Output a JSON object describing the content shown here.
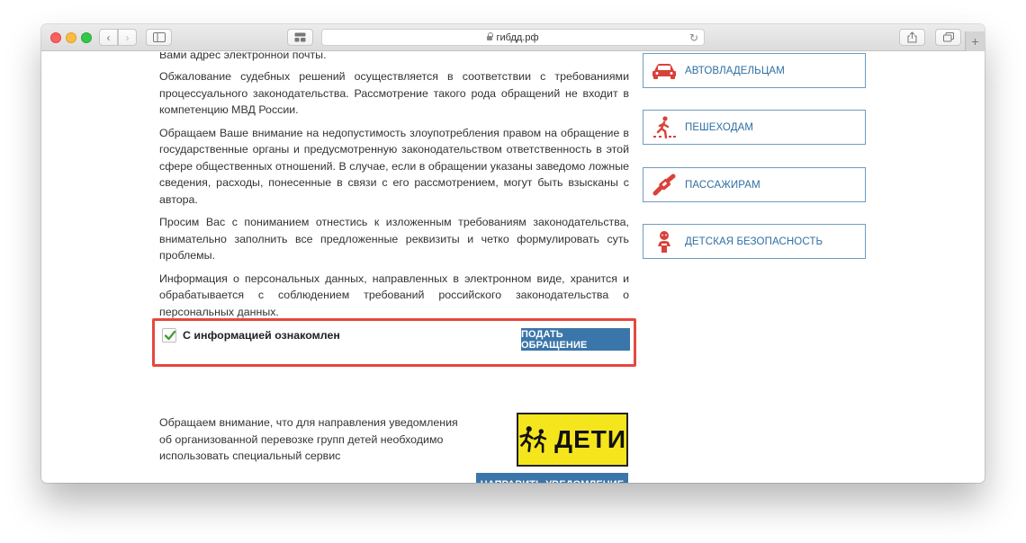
{
  "browser": {
    "address": "гибдд.рф",
    "back_glyph": "‹",
    "forward_glyph": "›",
    "new_tab_glyph": "+",
    "reload_glyph": "↻"
  },
  "main": {
    "paragraphs": [
      "Вами адрес электронной почты.",
      "Обжалование судебных решений осуществляется в соответствии с требованиями процессуального законодательства. Рассмотрение такого рода обращений не входит в компетенцию МВД России.",
      "Обращаем Ваше внимание на недопустимость злоупотребления правом на обращение в государственные органы и предусмотренную законодательством ответственность в этой сфере общественных отношений. В случае, если в обращении указаны заведомо ложные сведения, расходы, понесенные в связи с его рассмотрением, могут быть взысканы с автора.",
      "Просим Вас с пониманием отнестись к изложенным требованиям законодательства, внимательно заполнить все предложенные реквизиты и четко формулировать суть проблемы.",
      "Информация о персональных данных, направленных в электронном виде, хранится и обрабатывается с соблюдением требований российского законодательства о персональных данных."
    ],
    "consent_label": "С информацией ознакомлен",
    "consent_checked": true,
    "submit_label": "ПОДАТЬ ОБРАЩЕНИЕ",
    "notice_text": "Обращаем внимание, что для направления уведомления об организованной перевозке групп детей необходимо использовать специальный сервис",
    "deti_sign_text": "ДЕТИ",
    "notify_label": "НАПРАВИТЬ УВЕДОМЛЕНИЕ"
  },
  "sidebar": {
    "items": [
      {
        "label": "АВТОВЛАДЕЛЬЦАМ",
        "icon": "car-icon"
      },
      {
        "label": "ПЕШЕХОДАМ",
        "icon": "pedestrian-icon"
      },
      {
        "label": "ПАССАЖИРАМ",
        "icon": "seatbelt-icon"
      },
      {
        "label": "ДЕТСКАЯ БЕЗОПАСНОСТЬ",
        "icon": "child-icon"
      }
    ]
  },
  "colors": {
    "accent_blue": "#3a76a9",
    "sidebar_text": "#2e6fa4",
    "highlight_red": "#e5483e",
    "sign_yellow": "#f5e51c",
    "icon_red": "#d9413a"
  }
}
